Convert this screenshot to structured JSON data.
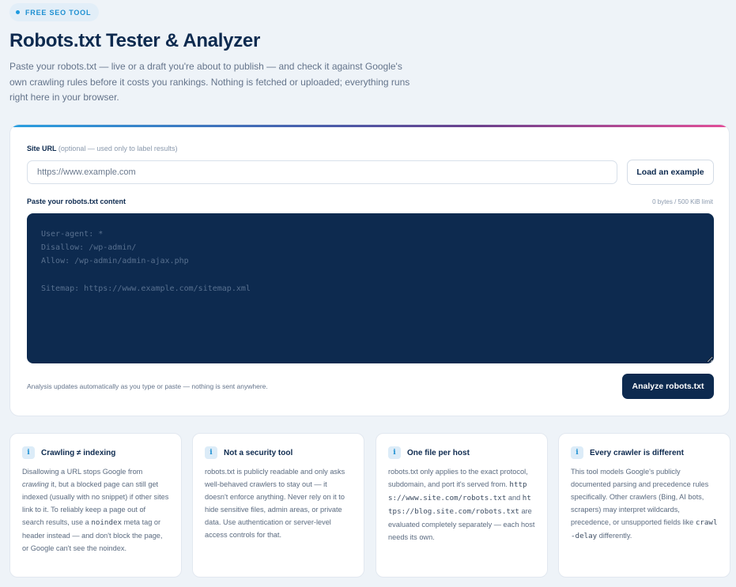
{
  "header": {
    "badge": "FREE SEO TOOL",
    "title": "Robots.txt Tester & Analyzer",
    "lede": "Paste your robots.txt — live or a draft you're about to publish — and check it against Google's own crawling rules before it costs you rankings. Nothing is fetched or uploaded; everything runs right here in your browser."
  },
  "form": {
    "site_url_label": "Site URL",
    "site_url_hint": "(optional — used only to label results)",
    "site_url_placeholder": "https://www.example.com",
    "site_url_value": "",
    "example_button": "Load an example",
    "content_label": "Paste your robots.txt content",
    "byte_counter": "0 bytes / 500 KiB limit",
    "content_placeholder": "User-agent: *\nDisallow: /wp-admin/\nAllow: /wp-admin/admin-ajax.php\n\nSitemap: https://www.example.com/sitemap.xml",
    "content_value": "",
    "note": "Analysis updates automatically as you type or paste — nothing is sent anywhere.",
    "analyze_button": "Analyze robots.txt"
  },
  "tips": [
    {
      "icon": "i",
      "title": "Crawling ≠ indexing",
      "body": [
        {
          "t": "Disallowing a URL stops Google from "
        },
        {
          "t": "crawling",
          "em": true
        },
        {
          "t": " it, but a blocked page can still get indexed (usually with no snippet) if other sites link to it. To reliably keep a page out of search results, use a "
        },
        {
          "t": "noindex",
          "code": true
        },
        {
          "t": " meta tag or header instead — and don't block the page, or Google can't see the noindex."
        }
      ]
    },
    {
      "icon": "i",
      "title": "Not a security tool",
      "body": [
        {
          "t": "robots.txt is publicly readable and only asks well-behaved crawlers to stay out — it doesn't enforce anything. Never rely on it to hide sensitive files, admin areas, or private data. Use authentication or server-level access controls for that."
        }
      ]
    },
    {
      "icon": "i",
      "title": "One file per host",
      "body": [
        {
          "t": "robots.txt only applies to the exact protocol, subdomain, and port it's served from. "
        },
        {
          "t": "https://www.site.com/robots.txt",
          "code": true
        },
        {
          "t": " and "
        },
        {
          "t": "https://blog.site.com/robots.txt",
          "code": true
        },
        {
          "t": " are evaluated completely separately — each host needs its own."
        }
      ]
    },
    {
      "icon": "i",
      "title": "Every crawler is different",
      "body": [
        {
          "t": "This tool models Google's publicly documented parsing and precedence rules specifically. Other crawlers (Bing, AI bots, scrapers) may interpret wildcards, precedence, or unsupported fields like "
        },
        {
          "t": "crawl-delay",
          "code": true
        },
        {
          "t": " differently."
        }
      ]
    }
  ]
}
